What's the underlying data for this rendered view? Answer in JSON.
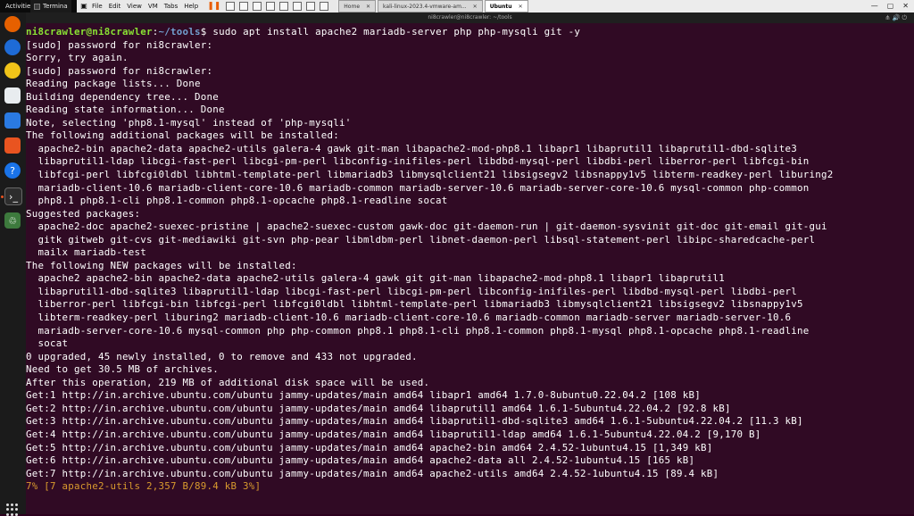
{
  "topbar": {
    "activities": "Activities",
    "terminal_tab": "Termina",
    "menu": [
      "File",
      "Edit",
      "View",
      "VM",
      "Tabs",
      "Help"
    ],
    "vm_tabs": [
      {
        "label": "Home",
        "active": false
      },
      {
        "label": "kali-linux-2023.4-vmware-am...",
        "active": false
      },
      {
        "label": "Ubuntu",
        "active": true
      }
    ]
  },
  "terminal": {
    "title": "ni8crawler@ni8crawler: ~/tools",
    "prompt": {
      "user": "ni8crawler@ni8crawler",
      "sep": ":",
      "path": "~/tools",
      "symbol": "$ ",
      "command": "sudo apt install apache2 mariadb-server php php-mysqli git -y"
    },
    "lines": [
      "[sudo] password for ni8crawler:",
      "Sorry, try again.",
      "[sudo] password for ni8crawler:",
      "Reading package lists... Done",
      "Building dependency tree... Done",
      "Reading state information... Done",
      "Note, selecting 'php8.1-mysql' instead of 'php-mysqli'",
      "The following additional packages will be installed:",
      "  apache2-bin apache2-data apache2-utils galera-4 gawk git-man libapache2-mod-php8.1 libapr1 libaprutil1 libaprutil1-dbd-sqlite3",
      "  libaprutil1-ldap libcgi-fast-perl libcgi-pm-perl libconfig-inifiles-perl libdbd-mysql-perl libdbi-perl liberror-perl libfcgi-bin",
      "  libfcgi-perl libfcgi0ldbl libhtml-template-perl libmariadb3 libmysqlclient21 libsigsegv2 libsnappy1v5 libterm-readkey-perl liburing2",
      "  mariadb-client-10.6 mariadb-client-core-10.6 mariadb-common mariadb-server-10.6 mariadb-server-core-10.6 mysql-common php-common",
      "  php8.1 php8.1-cli php8.1-common php8.1-opcache php8.1-readline socat",
      "Suggested packages:",
      "  apache2-doc apache2-suexec-pristine | apache2-suexec-custom gawk-doc git-daemon-run | git-daemon-sysvinit git-doc git-email git-gui",
      "  gitk gitweb git-cvs git-mediawiki git-svn php-pear libmldbm-perl libnet-daemon-perl libsql-statement-perl libipc-sharedcache-perl",
      "  mailx mariadb-test",
      "The following NEW packages will be installed:",
      "  apache2 apache2-bin apache2-data apache2-utils galera-4 gawk git git-man libapache2-mod-php8.1 libapr1 libaprutil1",
      "  libaprutil1-dbd-sqlite3 libaprutil1-ldap libcgi-fast-perl libcgi-pm-perl libconfig-inifiles-perl libdbd-mysql-perl libdbi-perl",
      "  liberror-perl libfcgi-bin libfcgi-perl libfcgi0ldbl libhtml-template-perl libmariadb3 libmysqlclient21 libsigsegv2 libsnappy1v5",
      "  libterm-readkey-perl liburing2 mariadb-client-10.6 mariadb-client-core-10.6 mariadb-common mariadb-server mariadb-server-10.6",
      "  mariadb-server-core-10.6 mysql-common php php-common php8.1 php8.1-cli php8.1-common php8.1-mysql php8.1-opcache php8.1-readline",
      "  socat",
      "0 upgraded, 45 newly installed, 0 to remove and 433 not upgraded.",
      "Need to get 30.5 MB of archives.",
      "After this operation, 219 MB of additional disk space will be used.",
      "Get:1 http://in.archive.ubuntu.com/ubuntu jammy-updates/main amd64 libapr1 amd64 1.7.0-8ubuntu0.22.04.2 [108 kB]",
      "Get:2 http://in.archive.ubuntu.com/ubuntu jammy-updates/main amd64 libaprutil1 amd64 1.6.1-5ubuntu4.22.04.2 [92.8 kB]",
      "Get:3 http://in.archive.ubuntu.com/ubuntu jammy-updates/main amd64 libaprutil1-dbd-sqlite3 amd64 1.6.1-5ubuntu4.22.04.2 [11.3 kB]",
      "Get:4 http://in.archive.ubuntu.com/ubuntu jammy-updates/main amd64 libaprutil1-ldap amd64 1.6.1-5ubuntu4.22.04.2 [9,170 B]",
      "Get:5 http://in.archive.ubuntu.com/ubuntu jammy-updates/main amd64 apache2-bin amd64 2.4.52-1ubuntu4.15 [1,349 kB]",
      "Get:6 http://in.archive.ubuntu.com/ubuntu jammy-updates/main amd64 apache2-data all 2.4.52-1ubuntu4.15 [165 kB]",
      "Get:7 http://in.archive.ubuntu.com/ubuntu jammy-updates/main amd64 apache2-utils amd64 2.4.52-1ubuntu4.15 [89.4 kB]"
    ],
    "progress_line": "7% [7 apache2-utils 2,357 B/89.4 kB 3%]"
  },
  "colors": {
    "terminal_bg": "#300a24",
    "prompt_user": "#8ae234",
    "prompt_path": "#729fcf",
    "progress_text": "#d99b2e",
    "accent": "#e95420"
  },
  "dock": [
    "firefox-icon",
    "thunderbird-icon",
    "rhythmbox-icon",
    "libreoffice-writer-icon",
    "app-store-icon",
    "help-icon",
    "terminal-icon",
    "trash-icon",
    "show-apps-icon"
  ]
}
